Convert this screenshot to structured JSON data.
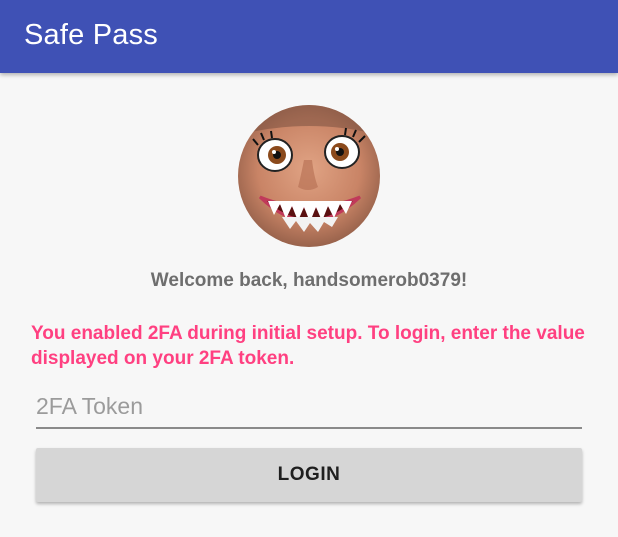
{
  "app_bar": {
    "title": "Safe Pass",
    "color": "#3f51b5"
  },
  "avatar": {
    "icon": "user-avatar-face"
  },
  "welcome": {
    "text": "Welcome back, handsomerob0379!"
  },
  "warning": {
    "text": "You enabled 2FA during initial setup. To login, enter the value displayed on your 2FA token.",
    "color": "#ff4081"
  },
  "token_input": {
    "placeholder": "2FA Token",
    "value": ""
  },
  "login_button": {
    "label": "LOGIN"
  }
}
